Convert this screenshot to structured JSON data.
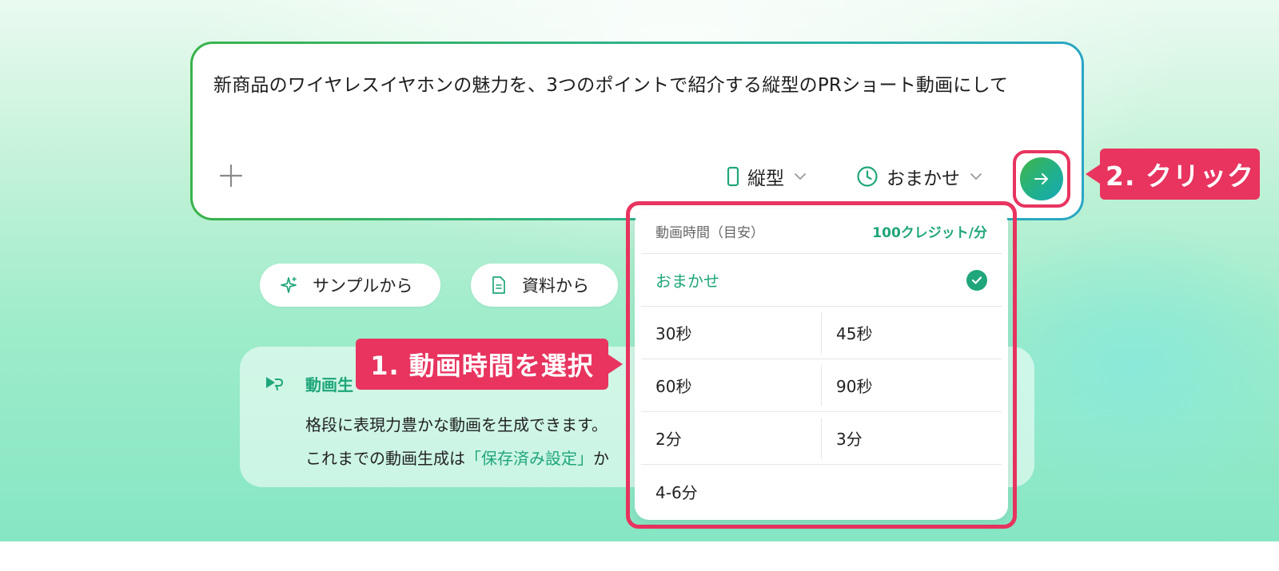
{
  "prompt": {
    "text": "新商品のワイヤレスイヤホンの魅力を、3つのポイントで紹介する縦型のPRショート動画にして",
    "orientation_label": "縦型",
    "duration_label": "おまかせ"
  },
  "chips": {
    "sample_label": "サンプルから",
    "doc_label": "資料から"
  },
  "info": {
    "title": "動画生",
    "line1": "格段に表現力豊かな動画を生成できます。",
    "line2_prefix": "これまでの動画生成は",
    "line2_link": "「保存済み設定」",
    "line2_suffix": "か"
  },
  "callouts": {
    "step1": "1. 動画時間を選択",
    "step2": "2. クリック"
  },
  "dropdown": {
    "header_label": "動画時間（目安）",
    "credit_label": "100クレジット/分",
    "auto_label": "おまかせ",
    "options": [
      "30秒",
      "45秒",
      "60秒",
      "90秒",
      "2分",
      "3分",
      "4-6分"
    ]
  },
  "colors": {
    "accent": "#1fa67a",
    "callout": "#e8345f"
  }
}
